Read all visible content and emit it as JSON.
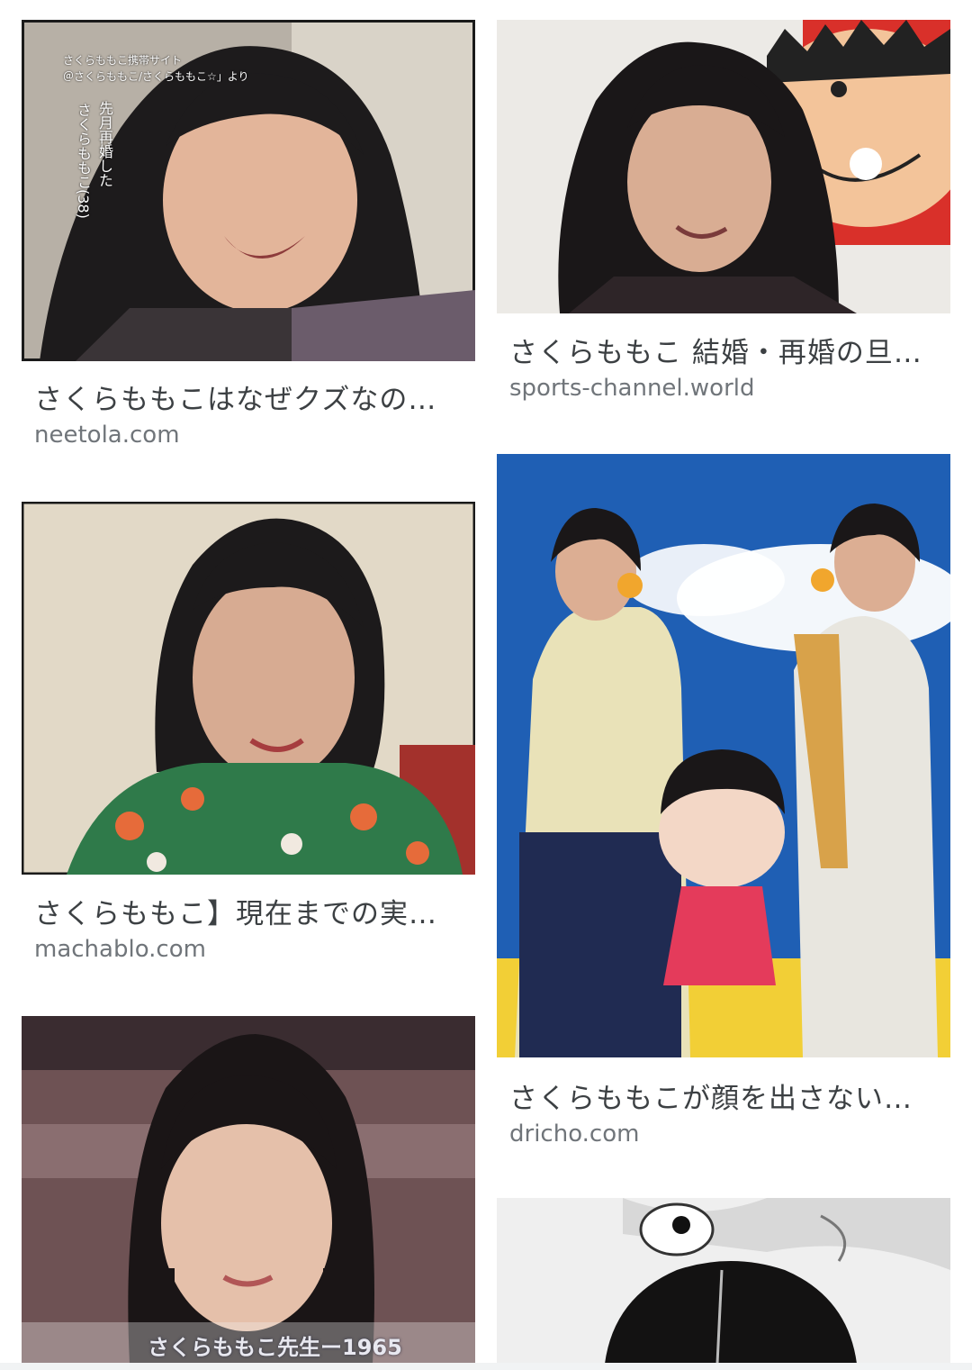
{
  "results": [
    {
      "title": "さくらももこはなぜクズなの…",
      "source": "neetola.com",
      "overlay_caption_line1": "さくらももこ携帯サイト",
      "overlay_caption_line2": "＠さくらももこ/さくらももこ☆」より",
      "overlay_vertical": "先月再婚した",
      "overlay_name": "さくらももこ(38)"
    },
    {
      "title": "さくらももこ 結婚・再婚の旦…",
      "source": "sports-channel.world"
    },
    {
      "title": "さくらももこ】現在までの実…",
      "source": "machablo.com"
    },
    {
      "title": "さくらももこが顔を出さない…",
      "source": "dricho.com"
    },
    {
      "title": "",
      "source": "",
      "overlay_caption": "さくらももこ先生ー1965"
    },
    {
      "title": "",
      "source": ""
    }
  ]
}
